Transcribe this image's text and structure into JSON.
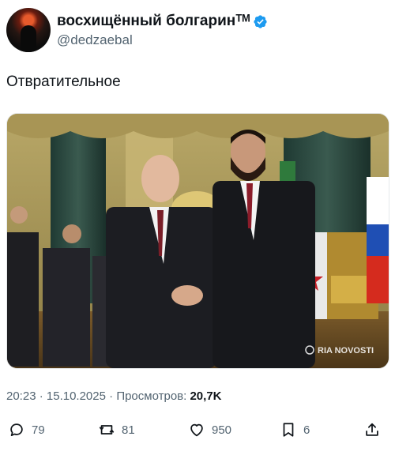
{
  "author": {
    "display_name": "восхищённый болгаринᵀᴹ",
    "handle": "@dedzaebal",
    "verified": true
  },
  "tweet": {
    "text": "Отвратительное"
  },
  "photo": {
    "watermark": "RIA NOVOSTI"
  },
  "meta": {
    "time": "20:23",
    "separator": "·",
    "date": "15.10.2025",
    "views_label": "Просмотров:",
    "views_count": "20,7K"
  },
  "actions": {
    "replies": "79",
    "reposts": "81",
    "likes": "950",
    "bookmarks": "6"
  },
  "colors": {
    "verified": "#1d9bf0",
    "muted": "#536471",
    "text": "#0f1419"
  }
}
